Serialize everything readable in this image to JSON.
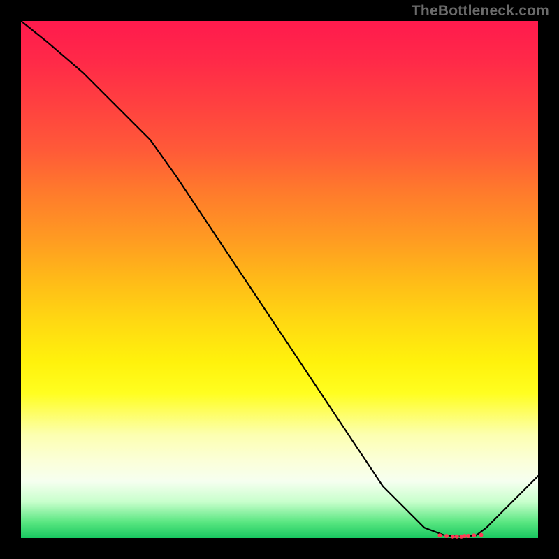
{
  "watermark": "TheBottleneck.com",
  "chart_data": {
    "type": "line",
    "title": "",
    "xlabel": "",
    "ylabel": "",
    "xlim": [
      0,
      100
    ],
    "ylim": [
      0,
      100
    ],
    "grid": false,
    "legend": false,
    "series": [
      {
        "name": "curve",
        "x": [
          0,
          5,
          12,
          20,
          25,
          30,
          40,
          50,
          60,
          70,
          78,
          82,
          85,
          88,
          90,
          93,
          100
        ],
        "y": [
          100,
          96,
          90,
          82,
          77,
          70,
          55,
          40,
          25,
          10,
          2,
          0.5,
          0.3,
          0.5,
          2,
          5,
          12
        ]
      }
    ],
    "markers": {
      "name": "highlight-dots",
      "x": [
        81.0,
        82.3,
        83.5,
        84.3,
        85.2,
        85.8,
        86.5,
        87.6,
        89.0
      ],
      "y": [
        0.5,
        0.4,
        0.3,
        0.3,
        0.3,
        0.4,
        0.4,
        0.5,
        0.6
      ],
      "r": 3
    }
  },
  "colors": {
    "curve": "#000000",
    "markers": "#ff3a55",
    "background_top": "#ff1a4d",
    "background_bottom": "#18c760",
    "frame": "#000000",
    "watermark": "#6a6a6a"
  }
}
